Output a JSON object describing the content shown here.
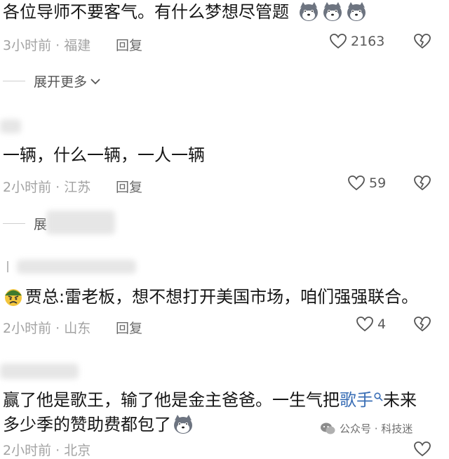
{
  "comments": [
    {
      "text": "各位导师不要客气。有什么梦想尽管题",
      "time": "3小时前",
      "location": "福建",
      "reply_label": "回复",
      "likes": "2163",
      "emoji_icons": [
        "husky-emoji-icon",
        "husky-emoji-icon",
        "husky-emoji-icon"
      ]
    },
    {
      "text": "一辆，什么一辆，一人一辆",
      "time": "2小时前",
      "location": "江苏",
      "reply_label": "回复",
      "likes": "59"
    },
    {
      "text": "贾总:雷老板，想不想打开美国市场，咱们强强联合。",
      "time": "2小时前",
      "location": "山东",
      "reply_label": "回复",
      "likes": "4",
      "leading_icon": "angry-face-emoji-icon"
    },
    {
      "text_before_link": "赢了他是歌王，输了他是金主爸爸。一生气把",
      "link_text": "歌手",
      "text_after_link": "未来",
      "text_line2": "多少季的赞助费都包了",
      "time": "2小时前",
      "location": "北京"
    }
  ],
  "expand_more_label": "展开更多",
  "expand_partial_label": "展",
  "meta_separator": "·",
  "watermark": {
    "icon": "wechat-official-account-icon",
    "text": "公众号 · 科技迷"
  },
  "colors": {
    "text": "#161616",
    "meta": "#a3a3a3",
    "link": "#3b6fb6"
  }
}
